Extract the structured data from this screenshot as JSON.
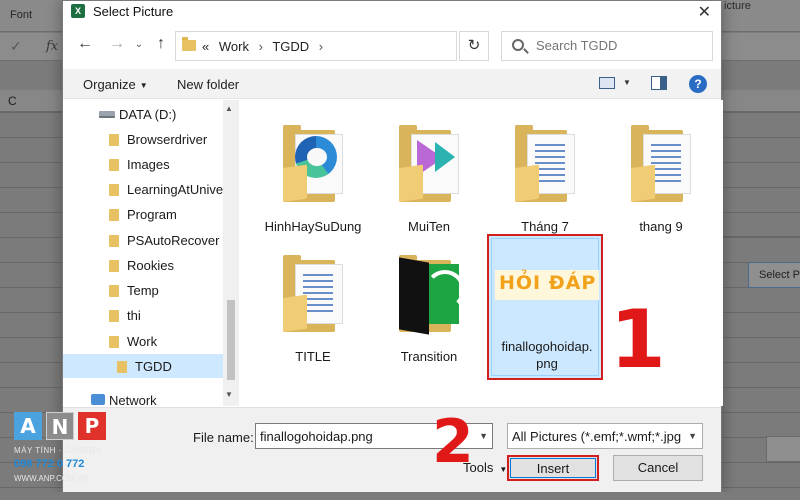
{
  "excel": {
    "ribbon_label": "Font",
    "fx": "fx",
    "check": "✓",
    "column_c": "C",
    "right_tab": "icture",
    "select_btn": "Select Pi"
  },
  "dialog": {
    "title": "Select Picture",
    "app_icon_letter": "X",
    "close": "✕",
    "nav": {
      "back": "←",
      "forward": "→",
      "recent": "⌄",
      "up": "↑"
    },
    "address": {
      "prefix": "«",
      "path": [
        "Work",
        "TGDD"
      ],
      "separator": "›",
      "dropdown": "⌄"
    },
    "refresh": "↻",
    "search": {
      "placeholder": "Search TGDD"
    },
    "commands": {
      "organize": "Organize",
      "new_folder": "New folder",
      "help": "?"
    },
    "sidebar": {
      "items": [
        {
          "label": "DATA (D:)",
          "type": "drive"
        },
        {
          "label": "Browserdriver",
          "type": "folder"
        },
        {
          "label": "Images",
          "type": "folder"
        },
        {
          "label": "LearningAtUniver",
          "type": "folder"
        },
        {
          "label": "Program",
          "type": "folder"
        },
        {
          "label": "PSAutoRecover",
          "type": "folder"
        },
        {
          "label": "Rookies",
          "type": "folder"
        },
        {
          "label": "Temp",
          "type": "folder"
        },
        {
          "label": "thi",
          "type": "folder"
        },
        {
          "label": "Work",
          "type": "folder"
        },
        {
          "label": "TGDD",
          "type": "folder",
          "selected": true
        },
        {
          "label": "Network",
          "type": "network"
        }
      ]
    },
    "files": [
      {
        "name": "HinhHaySuDung",
        "thumb": "edge"
      },
      {
        "name": "MuiTen",
        "thumb": "arrow"
      },
      {
        "name": "Tháng 7",
        "thumb": "doc"
      },
      {
        "name": "thang 9",
        "thumb": "doc"
      },
      {
        "name": "TITLE",
        "thumb": "doc"
      },
      {
        "name": "Transition",
        "thumb": "green"
      },
      {
        "name": "finallogohoidap.png",
        "thumb": "image",
        "selected": true,
        "line1": "finallogohoidap.",
        "line2": "png",
        "image_text": "HỎI ĐÁP"
      }
    ],
    "bottom": {
      "file_name_label": "File name:",
      "file_name_value": "finallogohoidap.png",
      "file_type": "All Pictures (*.emf;*.wmf;*.jpg;*.",
      "tools": "Tools",
      "insert": "Insert",
      "cancel": "Cancel"
    }
  },
  "annotations": {
    "step1": "1",
    "step2": "2"
  },
  "watermark": {
    "letters": [
      "A",
      "N",
      "P"
    ],
    "subtitle": "MÁY TÍNH · CAMERA",
    "phone": "098 772 0 772",
    "website": "WWW.ANP.COM.VN"
  },
  "colors": {
    "highlight": "#d31e1e",
    "selection": "#cce8ff",
    "accent": "#0078d7"
  }
}
